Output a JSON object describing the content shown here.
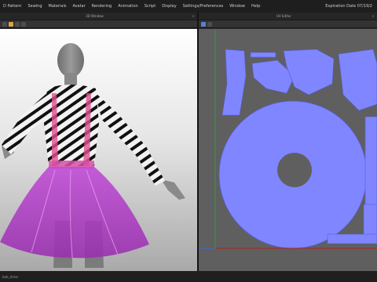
{
  "menu": {
    "items": [
      "D Pattern",
      "Sewing",
      "Materials",
      "Avatar",
      "Rendering",
      "Animation",
      "Script",
      "Display",
      "Settings/Preferences",
      "Window",
      "Help"
    ],
    "expiration": "Expiration Date 07/19/2"
  },
  "panels": {
    "view3d": {
      "title": "3D Window",
      "close": "×"
    },
    "view2d": {
      "title": "UV Editor",
      "close": "×"
    }
  },
  "status": {
    "text": "bab_dress"
  },
  "colors": {
    "uv_fill": "#7f86ff",
    "skirt": "#b43cc9",
    "viewport_bg": "#e6e6e6",
    "uv_bg": "#5f5f5f",
    "axis_green": "#2e9e3a",
    "axis_red": "#b02020"
  }
}
